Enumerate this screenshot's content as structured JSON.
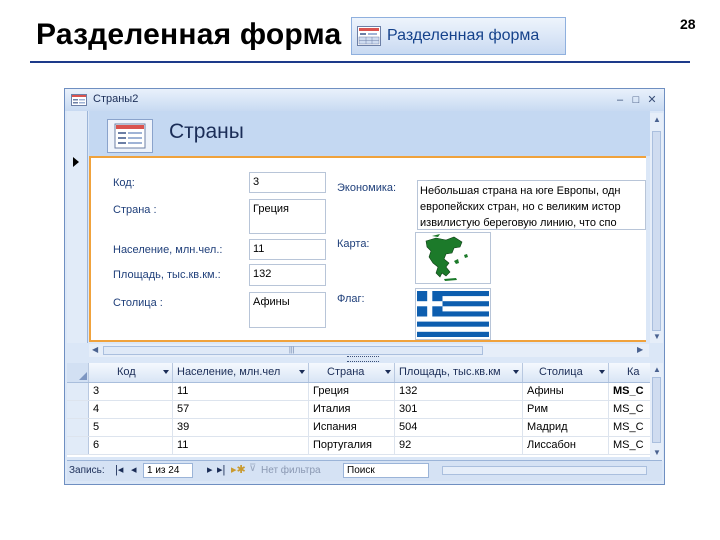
{
  "slide": {
    "title": "Разделенная форма",
    "page_number": "28",
    "ribbon_button_label": "Разделенная форма"
  },
  "window": {
    "title": "Страны2",
    "form_title": "Страны"
  },
  "form": {
    "code_label": "Код:",
    "code_value": "3",
    "country_label": "Страна :",
    "country_value": "Греция",
    "population_label": "Население, млн.чел.:",
    "population_value": "11",
    "area_label": "Площадь, тыс.кв.км.:",
    "area_value": "132",
    "capital_label": "Столица :",
    "capital_value": "Афины",
    "economy_label": "Экономика:",
    "economy_lines": [
      "Небольшая страна на юге Европы, одн",
      "европейских стран, но с великим истор",
      "извилистую береговую линию, что спо"
    ],
    "map_label": "Карта:",
    "flag_label": "Флаг:"
  },
  "grid": {
    "headers": [
      "Код",
      "Население, млн.чел",
      "Страна",
      "Площадь, тыс.кв.км",
      "Столица",
      "Ка"
    ],
    "rows": [
      [
        "3",
        "11",
        "Греция",
        "132",
        "Афины",
        "MS_C"
      ],
      [
        "4",
        "57",
        "Италия",
        "301",
        "Рим",
        "MS_C"
      ],
      [
        "5",
        "39",
        "Испания",
        "504",
        "Мадрид",
        "MS_C"
      ],
      [
        "6",
        "11",
        "Португалия",
        "92",
        "Лиссабон",
        "MS_C"
      ]
    ]
  },
  "navigation": {
    "record_label": "Запись:",
    "record_position": "1 из 24",
    "filter_label": "Нет фильтра",
    "search_placeholder": "Поиск"
  },
  "colors": {
    "form_border": "#f0a23c",
    "accent": "#15428b",
    "flag_blue": "#0d5eaf"
  }
}
